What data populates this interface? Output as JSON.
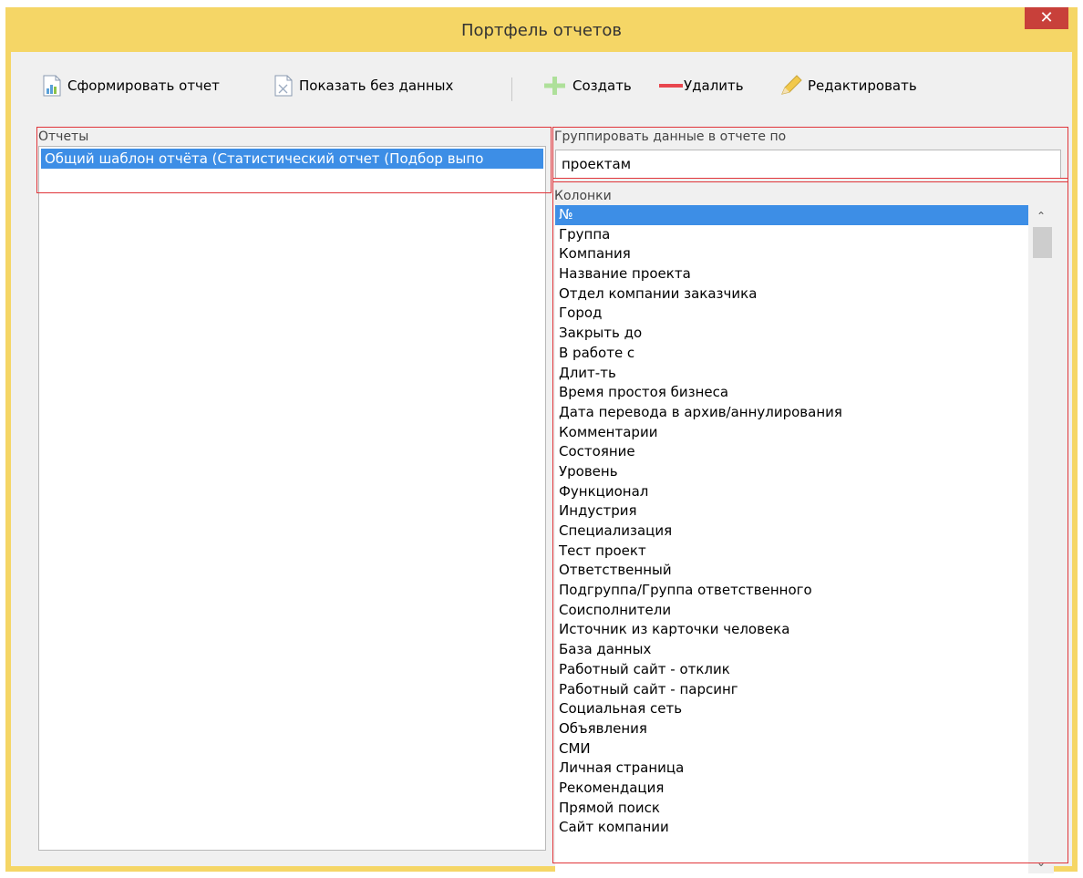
{
  "window": {
    "title": "Портфель отчетов",
    "close_glyph": "✕"
  },
  "toolbar": {
    "generate_label": "Сформировать отчет",
    "show_empty_label": "Показать без данных",
    "create_label": "Создать",
    "delete_label": "Удалить",
    "edit_label": "Редактировать"
  },
  "reports": {
    "label": "Отчеты",
    "items": [
      "Общий шаблон отчёта (Статистический отчет (Подбор выпо"
    ]
  },
  "group_by": {
    "label": "Группировать данные в отчете по",
    "value": "проектам"
  },
  "columns": {
    "label": "Колонки",
    "items": [
      "№",
      "Группа",
      "Компания",
      "Название проекта",
      "Отдел компании заказчика",
      "Город",
      "Закрыть до",
      "В работе с",
      "Длит-ть",
      "Время простоя бизнеса",
      "Дата перевода в архив/аннулирования",
      "Комментарии",
      "Состояние",
      "Уровень",
      "Функционал",
      "Индустрия",
      "Специализация",
      "Тест проект",
      "Ответственный",
      "Подгруппа/Группа ответственного",
      "Соисполнители",
      "Источник из карточки человека",
      "База данных",
      "Работный сайт - отклик",
      "Работный сайт - парсинг",
      "Социальная сеть",
      "Объявления",
      "СМИ",
      "Личная страница",
      "Рекомендация",
      "Прямой поиск",
      "Сайт компании"
    ],
    "scroll_up_glyph": "⌃",
    "scroll_down_glyph": "⌄"
  },
  "colors": {
    "titlebar": "#f5d666",
    "selection": "#3d8ee6",
    "highlight_box": "#e0353a",
    "close": "#c8403a"
  }
}
